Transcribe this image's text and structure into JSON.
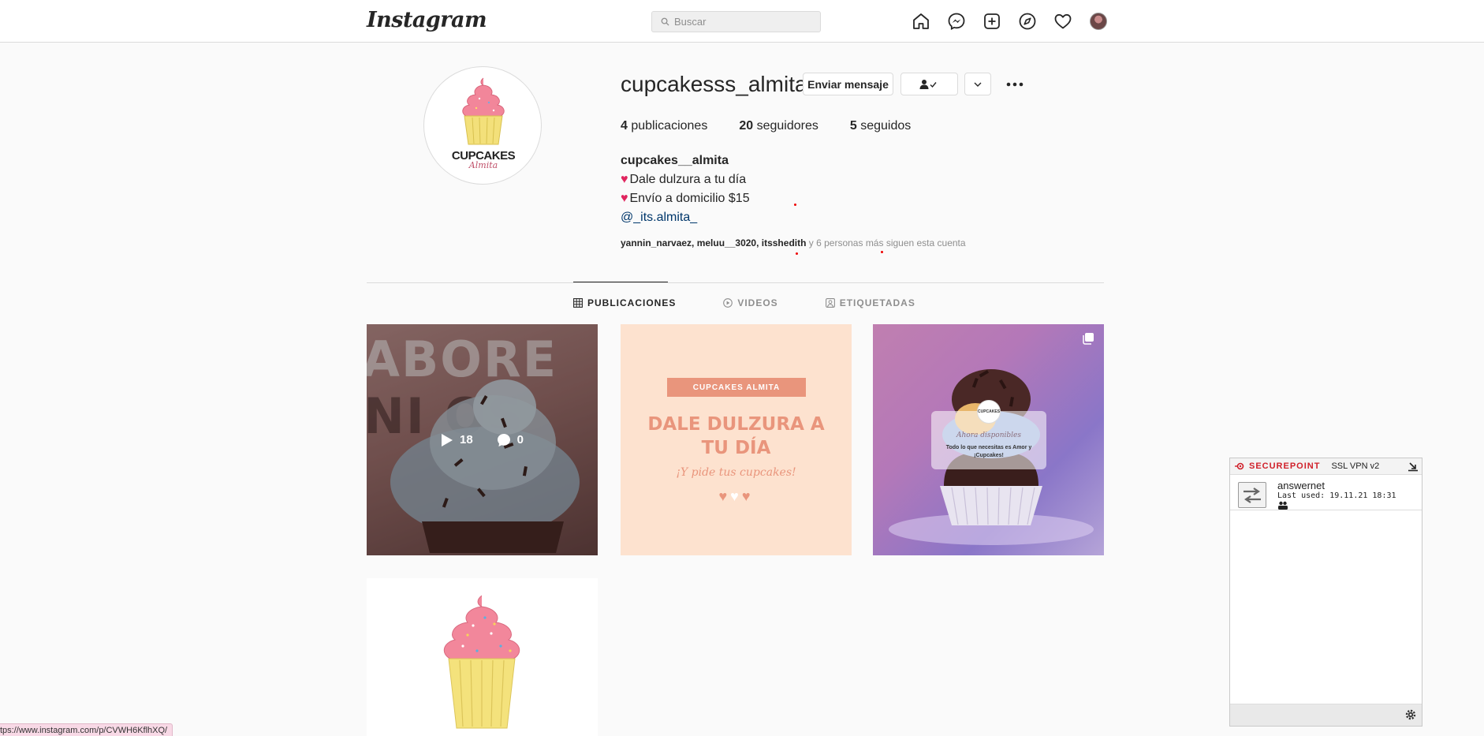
{
  "nav": {
    "logo": "Instagram",
    "search_placeholder": "Buscar",
    "icons": [
      "home-icon",
      "messenger-icon",
      "new-post-icon",
      "explore-icon",
      "activity-heart-icon",
      "profile-avatar"
    ]
  },
  "profile": {
    "username": "cupcakesss_almita",
    "message_button": "Enviar mensaje",
    "avatar_text": "CUPCAKES",
    "avatar_script": "Almita",
    "stats": {
      "posts_count": "4",
      "posts_label": "publicaciones",
      "followers_count": "20",
      "followers_label": "seguidores",
      "following_count": "5",
      "following_label": "seguidos"
    },
    "bio": {
      "name": "cupcakes__almita",
      "line1": "Dale dulzura a tu día",
      "line2": "Envío a domicilio $15",
      "link": "@_its.almita_"
    },
    "followed_by": {
      "users": "yannin_narvaez, meluu__3020, itsshedith",
      "rest": " y 6 personas más siguen esta cuenta"
    }
  },
  "tabs": {
    "posts": "PUBLICACIONES",
    "videos": "VIDEOS",
    "tagged": "ETIQUETADAS"
  },
  "posts": {
    "p1": {
      "bg_text_1": "ABORE",
      "bg_text_2": "NI OS",
      "plays": "18",
      "comments": "0"
    },
    "p2": {
      "badge": "CUPCAKES ALMITA",
      "title_line1": "DALE DULZURA A",
      "title_line2": "TU DÍA",
      "subtitle": "¡Y pide tus cupcakes!"
    },
    "p3": {
      "logo": "CUPCAKES",
      "script": "Ahora disponibles",
      "line": "Todo lo que necesitas es Amor y ¡Cupcakes!"
    }
  },
  "statusbar": {
    "url": "tps://www.instagram.com/p/CVWH6KflhXQ/"
  },
  "vpn": {
    "brand": "SECUREPOINT",
    "title": "SSL VPN v2",
    "connection_name": "answernet",
    "last_used": "Last used: 19.11.21 18:31"
  },
  "colors": {
    "accent_peach": "#e9957c",
    "link_blue": "#00376b",
    "heart_red": "#e0245e",
    "vpn_red": "#d0202a"
  }
}
